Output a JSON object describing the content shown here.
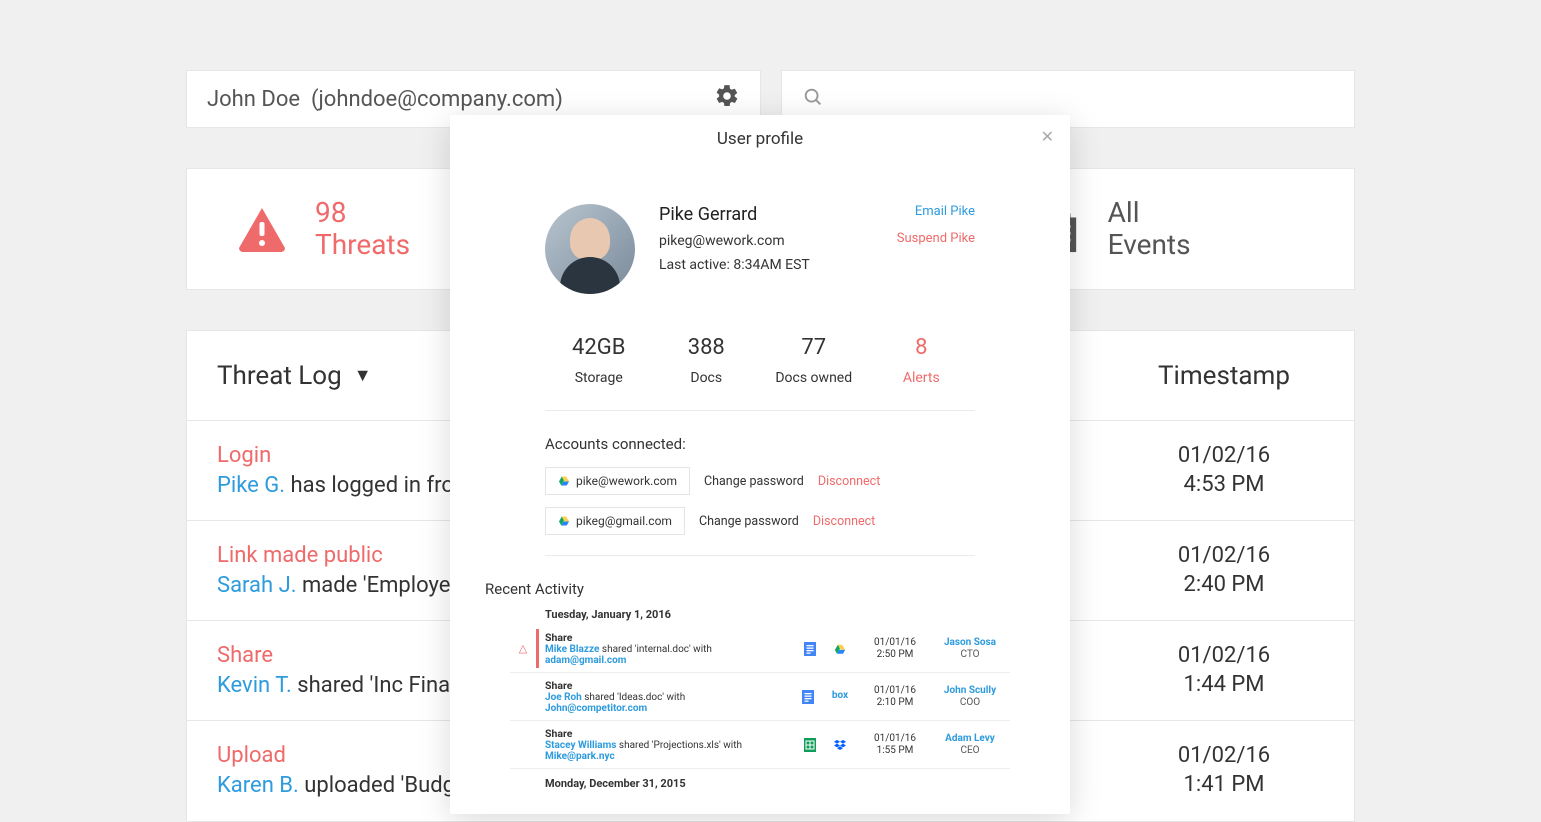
{
  "topbar": {
    "user_name": "John Doe",
    "user_email": "(johndoe@company.com)"
  },
  "cards": {
    "threats_count": "98",
    "threats_label": "Threats",
    "events_label_1": "All",
    "events_label_2": "Events"
  },
  "table": {
    "header_left": "Threat Log",
    "header_right": "Timestamp",
    "rows": [
      {
        "title": "Login",
        "actor": "Pike G.",
        "rest": " has logged in from",
        "date": "01/02/16",
        "time": "4:53 PM"
      },
      {
        "title": "Link made public",
        "actor": "Sarah J.",
        "rest": " made 'Employee",
        "date": "01/02/16",
        "time": "2:40 PM"
      },
      {
        "title": "Share",
        "actor": "Kevin T.",
        "rest": " shared 'Inc Financ",
        "date": "01/02/16",
        "time": "1:44 PM"
      },
      {
        "title": "Upload",
        "actor": "Karen B.",
        "rest": " uploaded 'Budge",
        "date": "01/02/16",
        "time": "1:41 PM"
      }
    ]
  },
  "modal": {
    "title": "User profile",
    "name": "Pike Gerrard",
    "email": "pikeg@wework.com",
    "last_active": "Last active: 8:34AM EST",
    "email_action": "Email Pike",
    "suspend_action": "Suspend Pike",
    "stats": [
      {
        "value": "42GB",
        "label": "Storage"
      },
      {
        "value": "388",
        "label": "Docs"
      },
      {
        "value": "77",
        "label": "Docs owned"
      },
      {
        "value": "8",
        "label": "Alerts",
        "alert": true
      }
    ],
    "accounts_title": "Accounts connected:",
    "accounts": [
      {
        "email": "pike@wework.com",
        "change": "Change password",
        "disconnect": "Disconnect"
      },
      {
        "email": "pikeg@gmail.com",
        "change": "Change password",
        "disconnect": "Disconnect"
      }
    ],
    "recent_title": "Recent Activity",
    "recent_groups": [
      {
        "date": "Tuesday, January 1, 2016",
        "items": [
          {
            "alert": true,
            "title": "Share",
            "actor": "Mike Blazze",
            "verb": " shared 'internal.doc' with ",
            "target": "adam@gmail.com",
            "date": "01/01/16",
            "time": "2:50 PM",
            "who": "Jason Sosa",
            "role": "CTO",
            "icon1": "doc",
            "icon2": "drive"
          },
          {
            "alert": false,
            "title": "Share",
            "actor": "Joe Roh",
            "verb": " shared 'Ideas.doc' with ",
            "target": "John@competitor.com",
            "date": "01/01/16",
            "time": "2:10 PM",
            "who": "John Scully",
            "role": "COO",
            "icon1": "doc",
            "icon2": "box"
          },
          {
            "alert": false,
            "title": "Share",
            "actor": "Stacey Williams",
            "verb": " shared 'Projections.xls' with ",
            "target": "Mike@park.nyc",
            "date": "01/01/16",
            "time": "1:55 PM",
            "who": "Adam Levy",
            "role": "CEO",
            "icon1": "sheet",
            "icon2": "dropbox"
          }
        ]
      },
      {
        "date": "Monday, December 31, 2015",
        "items": []
      }
    ]
  }
}
